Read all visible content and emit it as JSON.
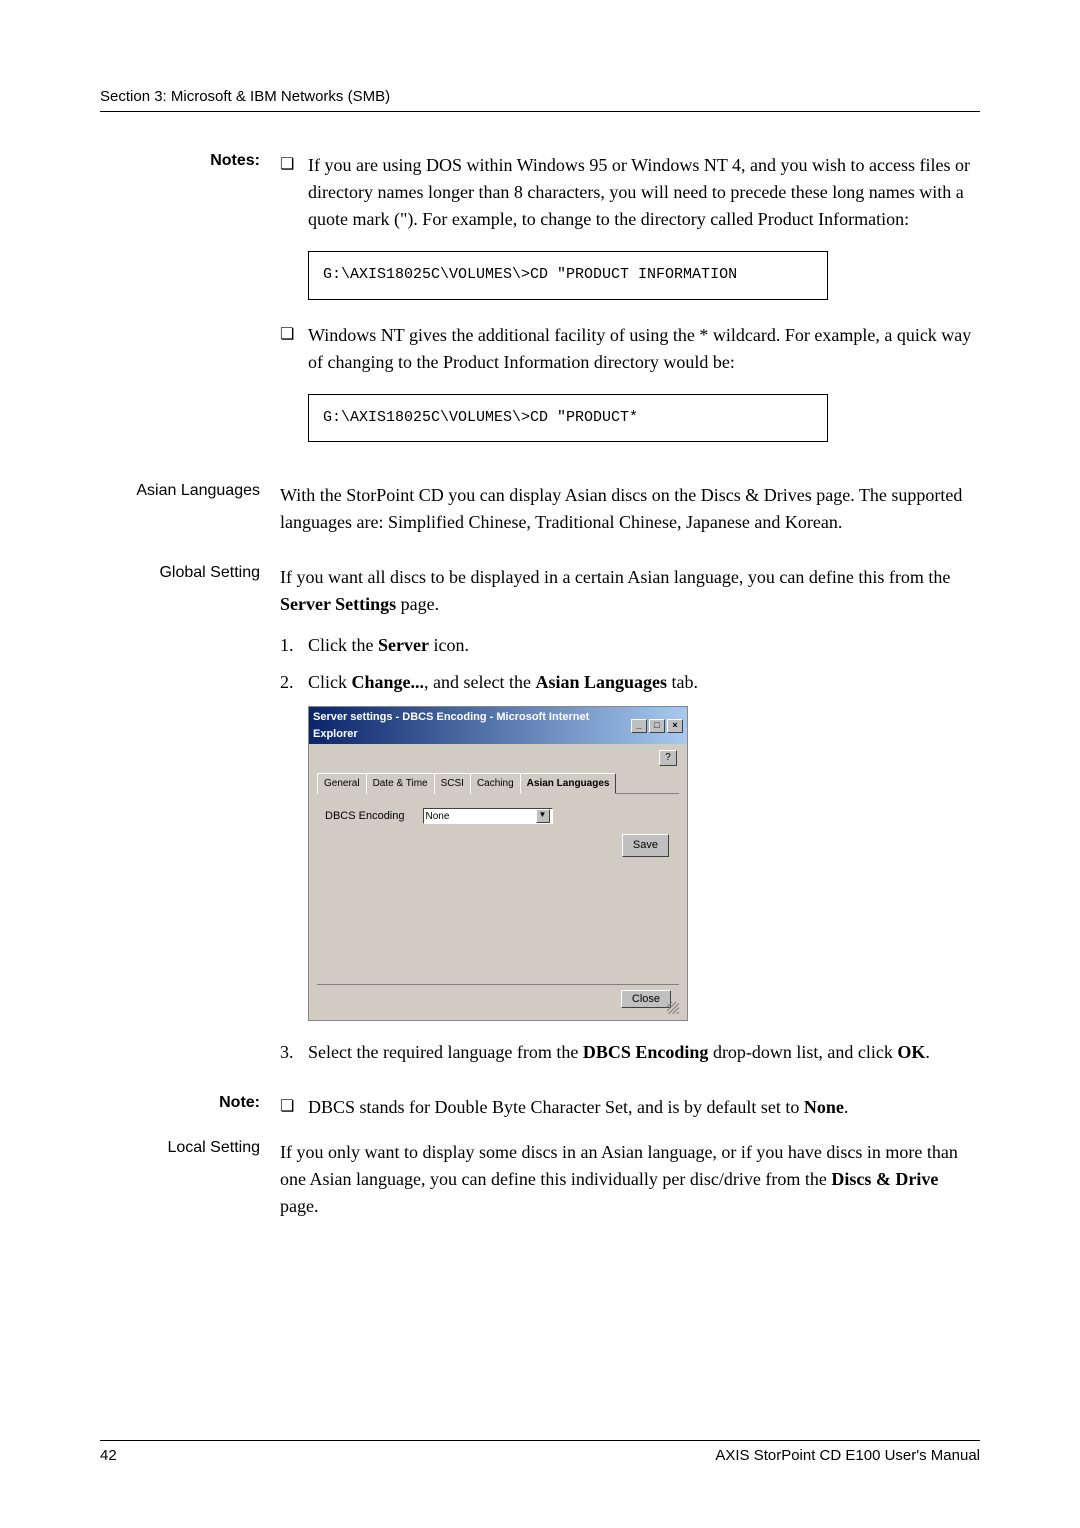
{
  "header": "Section 3: Microsoft & IBM Networks (SMB)",
  "labels": {
    "notes": "Notes:",
    "asian": "Asian Languages",
    "global": "Global Setting",
    "note": "Note:",
    "local": "Local Setting"
  },
  "notes_item1": "If you are using DOS within Windows 95 or Windows NT 4, and you wish to access files or directory names longer than 8 characters, you will need to precede these long names with a quote mark (\"). For example, to change to the directory called Product Information:",
  "code1": "G:\\AXIS18025C\\VOLUMES\\>CD \"PRODUCT INFORMATION",
  "notes_item2": "Windows NT gives the additional facility of using the * wildcard. For example, a quick way of changing to the Product Information directory would be:",
  "code2": "G:\\AXIS18025C\\VOLUMES\\>CD \"PRODUCT*",
  "asian_text": "With the StorPoint CD you can display Asian discs on the Discs & Drives page. The supported languages are: Simplified Chinese, Traditional Chinese, Japanese and Korean.",
  "global_intro_a": "If you want all discs to be displayed in a certain Asian language, you can define this from the ",
  "global_intro_b": "Server Settings",
  "global_intro_c": " page.",
  "ol1_a": "Click the ",
  "ol1_b": "Server",
  "ol1_c": " icon.",
  "ol2_a": "Click ",
  "ol2_b": "Change...",
  "ol2_c": ", and select the ",
  "ol2_d": "Asian Languages",
  "ol2_e": " tab.",
  "ol3_a": "Select the required language from the ",
  "ol3_b": "DBCS Encoding",
  "ol3_c": " drop-down list, and click ",
  "ol3_d": "OK",
  "ol3_e": ".",
  "note_text_a": "DBCS stands for Double Byte Character Set, and is by default set to ",
  "note_text_b": "None",
  "note_text_c": ".",
  "local_text_a": "If you only want to display some discs in an Asian language, or if you have discs in more than one Asian language, you can define this individually per disc/drive from the ",
  "local_text_b": "Discs & Drive",
  "local_text_c": " page.",
  "screenshot": {
    "title": "Server settings - DBCS Encoding - Microsoft Internet Explorer",
    "tabs": [
      "General",
      "Date & Time",
      "SCSI",
      "Caching",
      "Asian Languages"
    ],
    "field_label": "DBCS Encoding",
    "field_value": "None",
    "save": "Save",
    "close": "Close"
  },
  "footer": {
    "page": "42",
    "title": "AXIS StorPoint CD E100 User's Manual"
  }
}
